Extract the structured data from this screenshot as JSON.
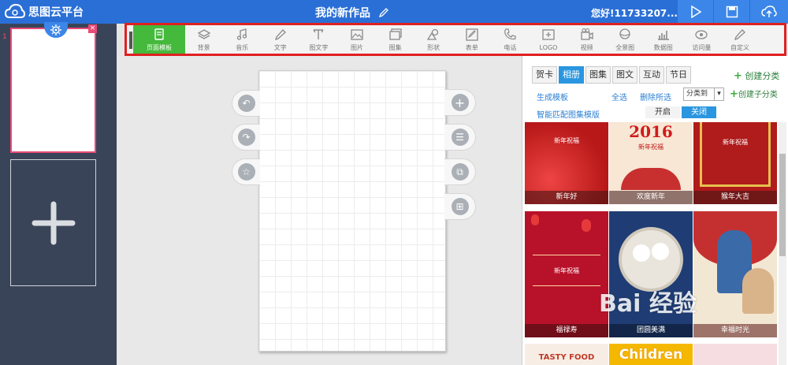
{
  "header": {
    "app_name": "思图云平台",
    "doc_title": "我的新作品",
    "greeting": "您好!11733207..."
  },
  "sidebar": {
    "page_number": "1",
    "close_label": "×"
  },
  "toolbar": {
    "items": [
      {
        "label": "页面模板",
        "icon": "page-template-icon",
        "active": true
      },
      {
        "label": "背景",
        "icon": "layers-icon"
      },
      {
        "label": "音乐",
        "icon": "music-icon"
      },
      {
        "label": "文字",
        "icon": "pen-icon"
      },
      {
        "label": "图文字",
        "icon": "image-text-icon"
      },
      {
        "label": "图片",
        "icon": "picture-icon"
      },
      {
        "label": "图集",
        "icon": "gallery-icon"
      },
      {
        "label": "形状",
        "icon": "shape-icon"
      },
      {
        "label": "表单",
        "icon": "form-icon"
      },
      {
        "label": "电话",
        "icon": "phone-icon"
      },
      {
        "label": "LOGO",
        "icon": "logo-icon"
      },
      {
        "label": "视频",
        "icon": "video-icon"
      },
      {
        "label": "全景图",
        "icon": "panorama-icon"
      },
      {
        "label": "数据图",
        "icon": "data-chart-icon"
      },
      {
        "label": "访问量",
        "icon": "eye-icon"
      },
      {
        "label": "自定义",
        "icon": "custom-pen-icon"
      }
    ]
  },
  "panel": {
    "categories": [
      {
        "label": "贺卡"
      },
      {
        "label": "相册",
        "active": true
      },
      {
        "label": "图集"
      },
      {
        "label": "图文"
      },
      {
        "label": "互动"
      },
      {
        "label": "节日"
      }
    ],
    "create_category": "创建分类",
    "generate_template": "生成模板",
    "select_all": "全选",
    "delete_selected": "删除所选",
    "category_select": "分类到",
    "create_subcategory": "创建子分类",
    "smart_match": "智能匹配图集模版",
    "toggle_on": "开启",
    "toggle_off": "关闭",
    "templates": [
      {
        "label": "新年好",
        "overlay": "新年祝福"
      },
      {
        "label": "欢度新年",
        "overlay": "2016",
        "sub": "新年祝福"
      },
      {
        "label": "猴年大吉",
        "overlay": "新年祝福"
      },
      {
        "label": "福禄寿",
        "overlay": "新年祝福"
      },
      {
        "label": "团圆美满"
      },
      {
        "label": "幸福时光"
      }
    ],
    "bottom_row": [
      "TASTY FOOD",
      "Children"
    ]
  },
  "watermark": "Bai 经验",
  "colors": {
    "topbar": "#2a6fd6",
    "active_tool": "#45b93c",
    "highlight_border": "#e02020",
    "accent_pink": "#e84b75",
    "tab_blue": "#2a96e0"
  }
}
